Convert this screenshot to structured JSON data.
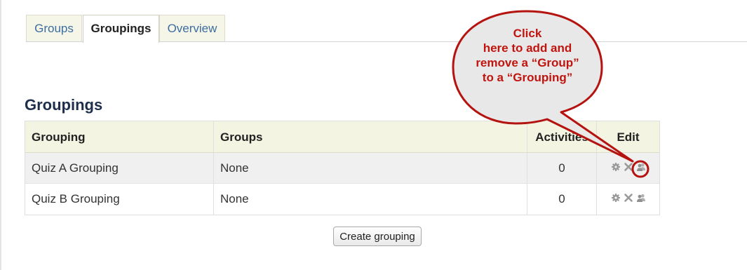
{
  "tabs": [
    {
      "label": "Groups"
    },
    {
      "label": "Groupings"
    },
    {
      "label": "Overview"
    }
  ],
  "active_tab": "Groupings",
  "heading": "Groupings",
  "table": {
    "columns": [
      "Grouping",
      "Groups",
      "Activities",
      "Edit"
    ],
    "rows": [
      {
        "grouping": "Quiz A Grouping",
        "groups": "None",
        "activities": "0",
        "edit_icons": [
          "gear-icon",
          "delete-x-icon",
          "people-icon"
        ]
      },
      {
        "grouping": "Quiz B Grouping",
        "groups": "None",
        "activities": "0",
        "edit_icons": [
          "gear-icon",
          "delete-x-icon",
          "people-icon"
        ]
      }
    ]
  },
  "create_button": "Create grouping",
  "callout": {
    "lines": [
      "Click",
      "here to add and",
      "remove a “Group”",
      "to a “Grouping”"
    ],
    "color": "#c0150f",
    "fill": "#e8e8e8"
  },
  "colors": {
    "link": "#3c6ea0",
    "heading": "#1d2f4a",
    "header_bg": "#f4f4e2",
    "icon_gray": "#9a9a9a"
  }
}
